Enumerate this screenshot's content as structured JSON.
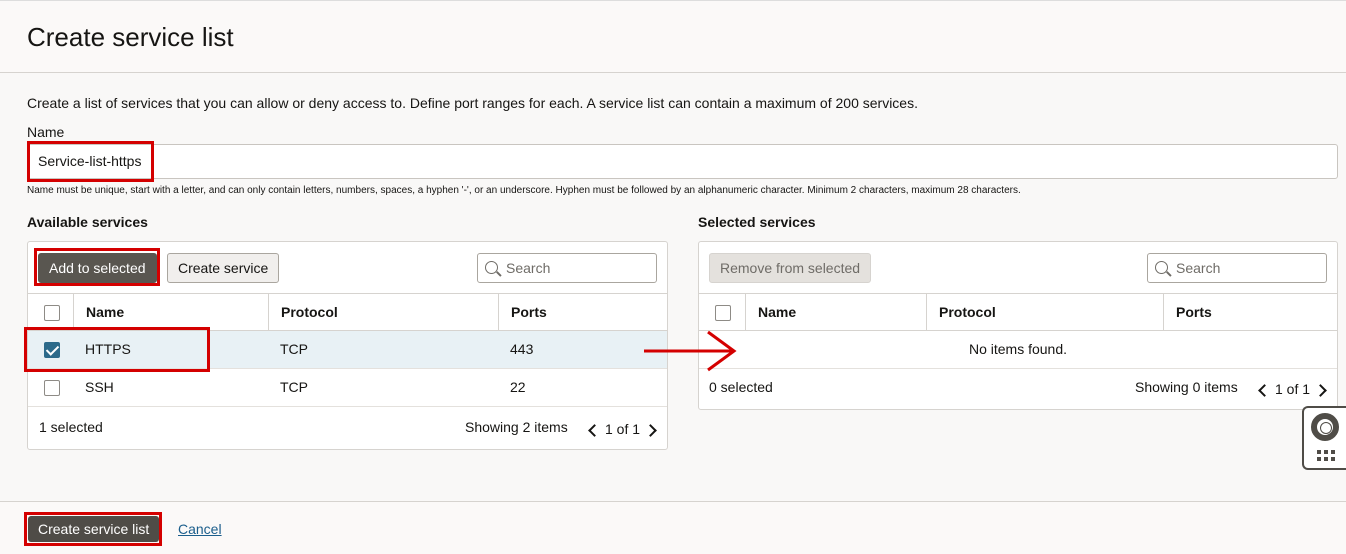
{
  "page": {
    "title": "Create service list"
  },
  "form": {
    "description": "Create a list of services that you can allow or deny access to. Define port ranges for each. A service list can contain a maximum of 200 services.",
    "name_label": "Name",
    "name_value": "Service-list-https",
    "name_hint": "Name must be unique, start with a letter, and can only contain letters, numbers, spaces, a hyphen '-', or an underscore. Hyphen must be followed by an alphanumeric character. Minimum 2 characters, maximum 28 characters."
  },
  "available": {
    "title": "Available services",
    "add_button": "Add to selected",
    "create_button": "Create service",
    "search_placeholder": "Search",
    "columns": [
      "Name",
      "Protocol",
      "Ports"
    ],
    "rows": [
      {
        "name": "HTTPS",
        "protocol": "TCP",
        "ports": "443",
        "checked": true
      },
      {
        "name": "SSH",
        "protocol": "TCP",
        "ports": "22",
        "checked": false
      }
    ],
    "selected_count": "1 selected",
    "showing": "Showing 2 items",
    "page": "1 of 1"
  },
  "selected": {
    "title": "Selected services",
    "remove_button": "Remove from selected",
    "search_placeholder": "Search",
    "columns": [
      "Name",
      "Protocol",
      "Ports"
    ],
    "empty": "No items found.",
    "selected_count": "0 selected",
    "showing": "Showing 0 items",
    "page": "1 of 1"
  },
  "footer": {
    "create_button": "Create service list",
    "cancel_link": "Cancel"
  },
  "colors": {
    "annotation": "#d40000",
    "primary": "#4f4c47",
    "selected_row": "#e8f1f5"
  },
  "icons": [
    "search-icon",
    "chevron-left-icon",
    "chevron-right-icon",
    "lifebuoy-icon",
    "apps-grid-icon",
    "arrow-annotation"
  ]
}
